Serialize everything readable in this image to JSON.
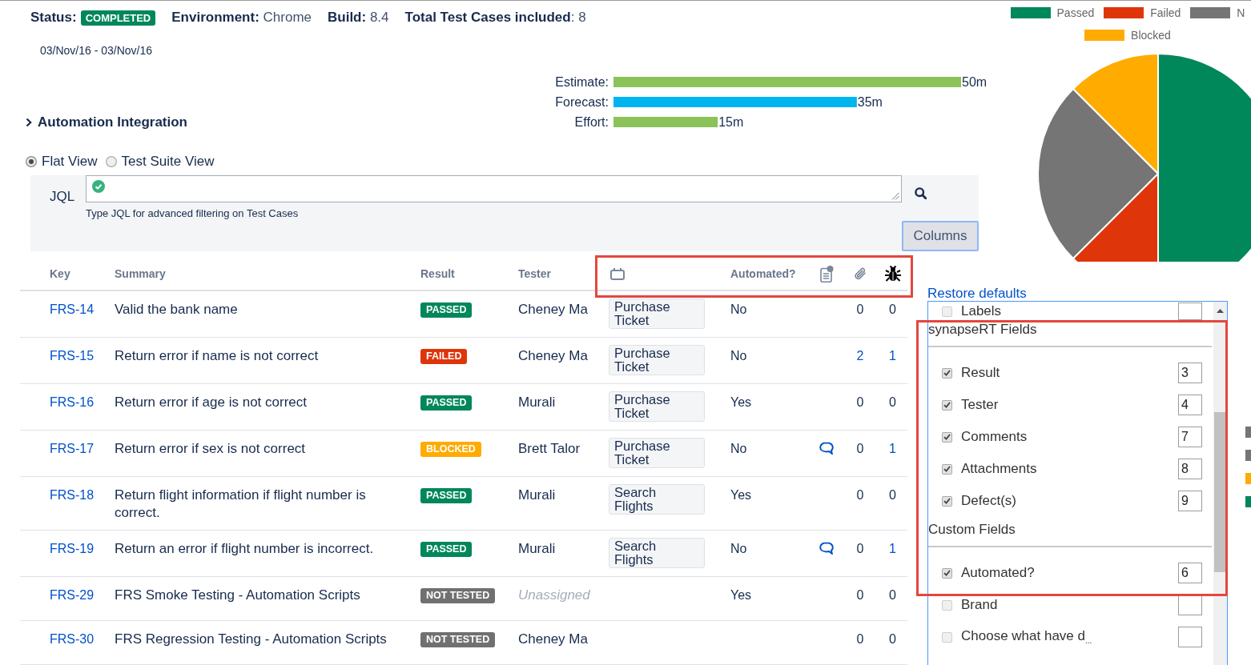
{
  "summary": {
    "status_label": "Status:",
    "status": "COMPLETED",
    "details": [
      "**Environment:** Chrome",
      "**Build:** 8.4",
      "**Total Test Cases included**: 8"
    ],
    "date_range": "03/Nov/16 - 03/Nov/16"
  },
  "time_chart": {
    "labels": [
      "Estimate:",
      "Forecast:",
      "Effort:"
    ],
    "chart_data": {
      "type": "bar",
      "orientation": "horizontal",
      "values": [
        50,
        35,
        15
      ],
      "value_labels": [
        "50m",
        "35m",
        "15m"
      ],
      "colors": [
        "#8bc35a",
        "#00b4f0",
        "#8bc35a"
      ]
    }
  },
  "automation_section": {
    "title": "Automation Integration",
    "expanded": false
  },
  "view_options": [
    {
      "label": "Flat View",
      "selected": true
    },
    {
      "label": "Test Suite View",
      "selected": false
    }
  ],
  "jql": {
    "label": "JQL",
    "valid": true,
    "hint": "Type JQL for advanced filtering on Test Cases",
    "button": "Columns"
  },
  "results_chart": {
    "chart_data": {
      "type": "pie",
      "legend": "top",
      "categories": [
        "Passed",
        "Failed",
        "N",
        "Blocked"
      ],
      "values": [
        50,
        12.5,
        25,
        12.5
      ],
      "colors": [
        "#00875a",
        "#de350b",
        "#757575",
        "#ffab00"
      ]
    }
  },
  "table": {
    "columns": [
      {
        "kind": "text",
        "label": "Key"
      },
      {
        "kind": "text",
        "label": "Summary"
      },
      {
        "kind": "text",
        "label": "Result"
      },
      {
        "kind": "text",
        "label": "Tester"
      },
      {
        "kind": "icon"
      },
      {
        "kind": "text",
        "label": "Automated?"
      },
      {
        "kind": "icon"
      },
      {
        "kind": "icon"
      },
      {
        "kind": "icon"
      }
    ],
    "rows": [
      {
        "key": "FRS-14",
        "summary": "Valid the bank name",
        "result": {
          "label": "PASSED",
          "color": "#00875a"
        },
        "tester": "Cheney Ma",
        "tester_assigned": true,
        "component": "Purchase Ticket",
        "automated": "No",
        "has_comments": false,
        "attachments": "0",
        "attachments_link": false,
        "defects": "0",
        "defects_link": false
      },
      {
        "key": "FRS-15",
        "summary": "Return error if name is not correct",
        "result": {
          "label": "FAILED",
          "color": "#de350b"
        },
        "tester": "Cheney Ma",
        "tester_assigned": true,
        "component": "Purchase Ticket",
        "automated": "No",
        "has_comments": false,
        "attachments": "2",
        "attachments_link": true,
        "defects": "1",
        "defects_link": true
      },
      {
        "key": "FRS-16",
        "summary": "Return error if age is not correct",
        "result": {
          "label": "PASSED",
          "color": "#00875a"
        },
        "tester": "Murali",
        "tester_assigned": true,
        "component": "Purchase Ticket",
        "automated": "Yes",
        "has_comments": false,
        "attachments": "0",
        "attachments_link": false,
        "defects": "0",
        "defects_link": false
      },
      {
        "key": "FRS-17",
        "summary": "Return error if sex is not correct",
        "result": {
          "label": "BLOCKED",
          "color": "#ffab00"
        },
        "tester": "Brett Talor",
        "tester_assigned": true,
        "component": "Purchase Ticket",
        "automated": "No",
        "has_comments": true,
        "attachments": "0",
        "attachments_link": false,
        "defects": "1",
        "defects_link": true
      },
      {
        "key": "FRS-18",
        "summary": "Return flight information if flight number is correct.",
        "result": {
          "label": "PASSED",
          "color": "#00875a"
        },
        "tester": "Murali",
        "tester_assigned": true,
        "component": "Search Flights",
        "automated": "Yes",
        "has_comments": false,
        "attachments": "0",
        "attachments_link": false,
        "defects": "0",
        "defects_link": false
      },
      {
        "key": "FRS-19",
        "summary": "Return an error if flight number is incorrect.",
        "result": {
          "label": "PASSED",
          "color": "#00875a"
        },
        "tester": "Murali",
        "tester_assigned": true,
        "component": "Search Flights",
        "automated": "No",
        "has_comments": true,
        "attachments": "0",
        "attachments_link": false,
        "defects": "1",
        "defects_link": true
      },
      {
        "key": "FRS-29",
        "summary": "FRS Smoke Testing - Automation Scripts",
        "result": {
          "label": "NOT TESTED",
          "color": "#707070"
        },
        "tester": "Unassigned",
        "tester_assigned": false,
        "automated": "Yes",
        "has_comments": false,
        "attachments": "0",
        "attachments_link": false,
        "defects": "0",
        "defects_link": false
      },
      {
        "key": "FRS-30",
        "summary": "FRS Regression Testing - Automation Scripts",
        "result": {
          "label": "NOT TESTED",
          "color": "#707070"
        },
        "tester": "Cheney Ma",
        "tester_assigned": true,
        "has_comments": false,
        "attachments": "0",
        "attachments_link": false,
        "defects": "0",
        "defects_link": false
      }
    ]
  },
  "column_settings": {
    "restore_link": "Restore defaults",
    "groups": [
      {
        "items": [
          {
            "label": "Labels",
            "checked": false
          }
        ]
      },
      {
        "title": "synapseRT Fields",
        "items": [
          {
            "label": "Result",
            "checked": true,
            "order": "3"
          },
          {
            "label": "Tester",
            "checked": true,
            "order": "4"
          },
          {
            "label": "Comments",
            "checked": true,
            "order": "7"
          },
          {
            "label": "Attachments",
            "checked": true,
            "order": "8"
          },
          {
            "label": "Defect(s)",
            "checked": true,
            "order": "9"
          }
        ]
      },
      {
        "title": "Custom Fields",
        "items": [
          {
            "label": "Automated?",
            "checked": true,
            "order": "6"
          },
          {
            "label": "Brand",
            "checked": false
          },
          {
            "label": "Choose what have d$_{...}$",
            "checked": false
          }
        ]
      }
    ]
  },
  "edge_swatches": [
    {
      "color": "#757575"
    },
    {
      "color": "#757575"
    },
    {
      "color": "#ffab00"
    },
    {
      "color": "#00875a"
    }
  ]
}
